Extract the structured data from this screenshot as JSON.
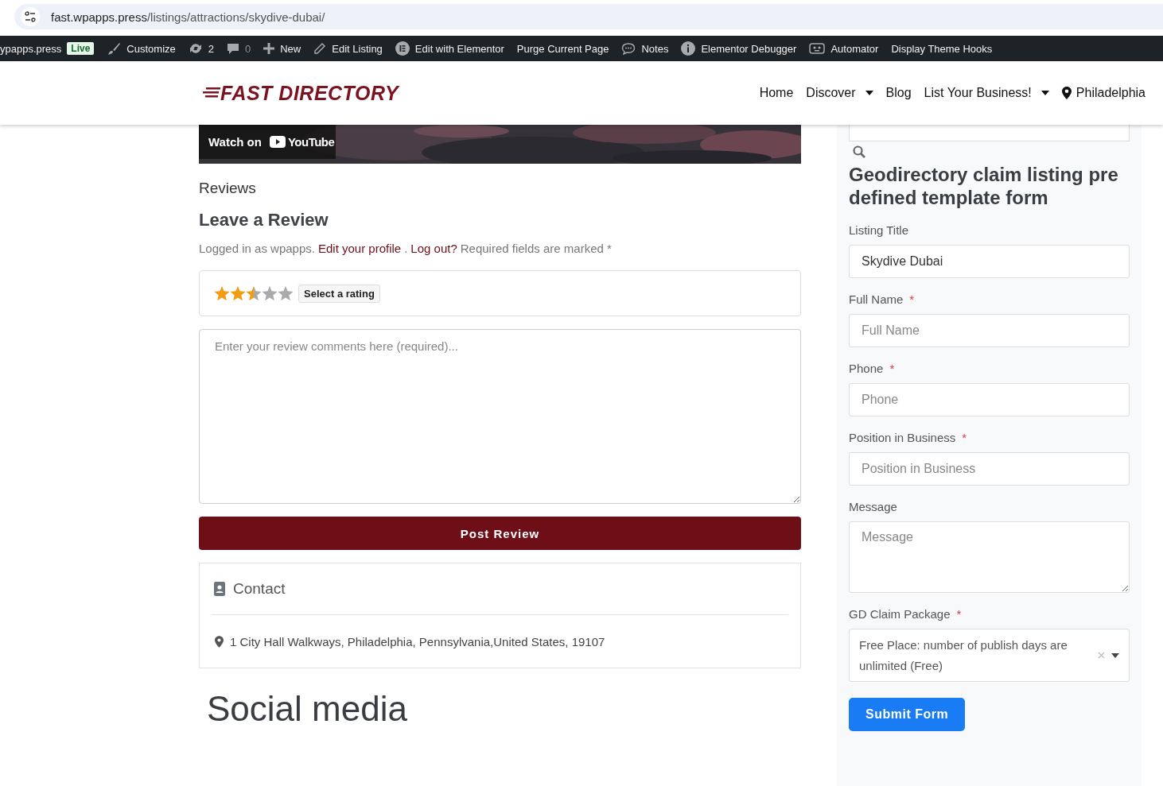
{
  "browser": {
    "url_host": "fast.wpapps.press",
    "url_path": "/listings/attractions/skydive-dubai/"
  },
  "admin_bar": [
    {
      "kind": "site",
      "label": "ypapps.press",
      "badge": "Live"
    },
    {
      "kind": "brush",
      "label": "Customize"
    },
    {
      "kind": "updates",
      "label": "2"
    },
    {
      "kind": "comments",
      "label": "0"
    },
    {
      "kind": "plus",
      "label": "New"
    },
    {
      "kind": "pencil",
      "label": "Edit Listing"
    },
    {
      "kind": "elementor",
      "label": "Edit with Elementor"
    },
    {
      "kind": "text",
      "label": "Purge Current Page"
    },
    {
      "kind": "chat",
      "label": "Notes"
    },
    {
      "kind": "info",
      "label": "Elementor Debugger"
    },
    {
      "kind": "robot",
      "label": "Automator"
    },
    {
      "kind": "text",
      "label": "Display Theme Hooks"
    }
  ],
  "header": {
    "logo": "FAST DIRECTORY",
    "nav": [
      {
        "label": "Home",
        "dropdown": false,
        "pin": false
      },
      {
        "label": "Discover",
        "dropdown": true,
        "pin": false
      },
      {
        "label": "Blog",
        "dropdown": false,
        "pin": false
      },
      {
        "label": "List Your Business!",
        "dropdown": true,
        "pin": false
      },
      {
        "label": "Philadelphia",
        "dropdown": false,
        "pin": true
      }
    ]
  },
  "video": {
    "watch": "Watch on",
    "brand": "YouTube"
  },
  "reviews": {
    "heading": "Reviews",
    "title": "Leave a Review",
    "logged_in": "Logged in as wpapps.",
    "edit_profile": "Edit your profile",
    "period": ".",
    "logout": "Log out?",
    "required": "Required fields are marked *",
    "stars": 2.5,
    "rating_label": "Select a rating",
    "comment_placeholder": "Enter your review comments here (required)...",
    "submit": "Post Review"
  },
  "contact": {
    "title": "Contact",
    "address": "1 City Hall Walkways, Philadelphia, Pennsylvania,United States, 19107"
  },
  "social_heading": "Social media",
  "claim_form": {
    "required_mark": "*",
    "title": "Geodirectory claim listing pre defined template form",
    "fields": [
      {
        "kind": "text",
        "label": "Listing Title",
        "required": false,
        "value": "Skydive Dubai"
      },
      {
        "kind": "text",
        "label": "Full Name",
        "required": true,
        "placeholder": "Full Name"
      },
      {
        "kind": "text",
        "label": "Phone",
        "required": true,
        "placeholder": "Phone"
      },
      {
        "kind": "text",
        "label": "Position in Business",
        "required": true,
        "placeholder": "Position in Business"
      },
      {
        "kind": "textarea",
        "label": "Message",
        "required": false,
        "placeholder": "Message"
      },
      {
        "kind": "select",
        "label": "GD Claim Package",
        "required": true,
        "value": "Free Place: number of publish days are unlimited (Free)"
      }
    ],
    "submit": "Submit Form"
  }
}
